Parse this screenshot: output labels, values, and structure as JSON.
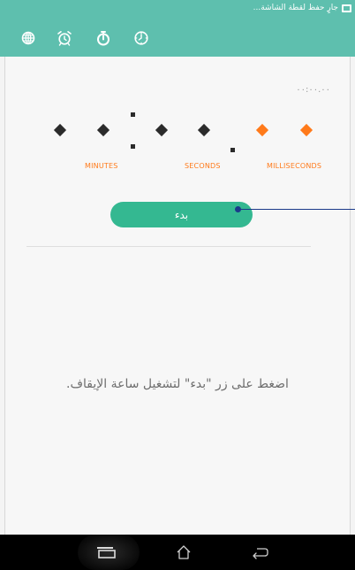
{
  "status_bar": {
    "notification_text": "جارٍ حفظ لقطة الشاشة...",
    "notification_icon": "screenshot-icon"
  },
  "tabs": [
    {
      "icon": "world-clock-icon",
      "selected": false
    },
    {
      "icon": "alarm-icon",
      "selected": false
    },
    {
      "icon": "stopwatch-icon",
      "selected": true
    },
    {
      "icon": "timer-icon",
      "selected": false
    }
  ],
  "stopwatch": {
    "time_small": "٠٠:٠٠.٠٠",
    "labels": {
      "minutes": "MINUTES",
      "seconds": "SECONDS",
      "milliseconds": "MILLISECONDS"
    },
    "start_button": "بدء",
    "hint": "اضغط على زر \"بدء\" لتشغيل ساعة الإيقاف."
  },
  "colors": {
    "app_bar": "#5ebfae",
    "start_button": "#34b891",
    "accent_orange": "#ff7a1a",
    "digit_dark": "#2b2b2b",
    "pointer": "#1b3a8a"
  },
  "nav_bar": {
    "buttons": [
      "recent-apps-icon",
      "home-icon",
      "back-icon"
    ]
  }
}
